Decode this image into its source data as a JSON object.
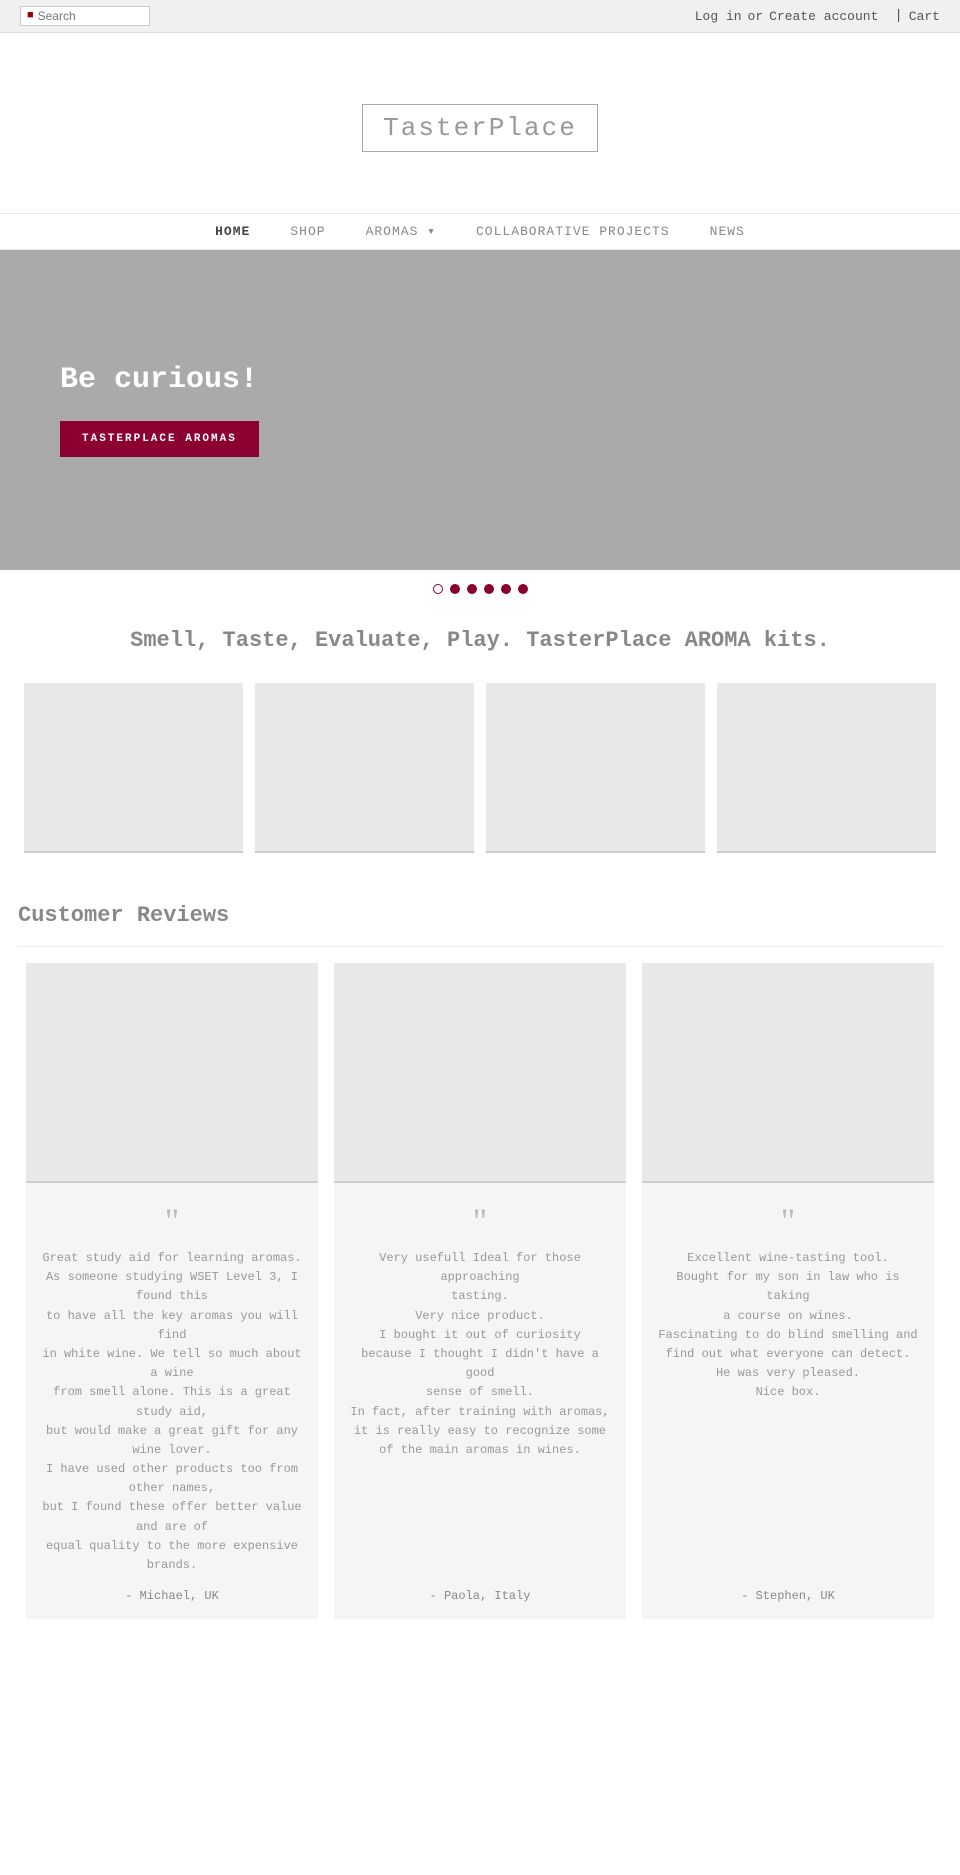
{
  "topbar": {
    "search_placeholder": "Search",
    "login_label": "Log in",
    "or_label": "or",
    "create_account_label": "Create account",
    "cart_divider": "|",
    "cart_label": "Cart"
  },
  "logo": {
    "text": "TasterPlace"
  },
  "nav": {
    "items": [
      {
        "label": "HOME",
        "active": true,
        "href": "#"
      },
      {
        "label": "SHOP",
        "active": false,
        "href": "#"
      },
      {
        "label": "AROMAS ▾",
        "active": false,
        "href": "#"
      },
      {
        "label": "COLLABORATIVE PROJECTS",
        "active": false,
        "href": "#"
      },
      {
        "label": "NEWS",
        "active": false,
        "href": "#"
      }
    ]
  },
  "hero": {
    "title": "Be curious!",
    "button_label": "TASTERPLACE AROMAS"
  },
  "carousel": {
    "dots": [
      {
        "type": "outline"
      },
      {
        "type": "filled"
      },
      {
        "type": "filled"
      },
      {
        "type": "filled"
      },
      {
        "type": "filled"
      },
      {
        "type": "filled"
      }
    ]
  },
  "tagline": {
    "text": "Smell, Taste, Evaluate, Play. TasterPlace AROMA kits."
  },
  "products": [
    {
      "name": ""
    },
    {
      "name": ""
    },
    {
      "name": ""
    },
    {
      "name": ""
    }
  ],
  "reviews_section": {
    "title": "Customer Reviews",
    "reviews": [
      {
        "quote_mark": "““",
        "text": "Great study aid for learning aromas.\nAs someone studying WSET Level 3, I found this\nto have all the key aromas you will find\nin white wine. We tell so much about a wine\nfrom smell alone. This is a great study aid,\nbut would make a great gift for any wine lover.\nI have used other products too from other names,\nbut I found these offer better value and are of\nequal quality to the more expensive brands.",
        "reviewer": "- Michael, UK"
      },
      {
        "quote_mark": "““",
        "text": "Very usefull Ideal for those approaching\ntasting.\nVery nice product.\nI bought it out of curiosity\nbecause I thought I didn't have a good\nsense of smell.\nIn fact, after training with aromas,\nit is really easy to recognize some\nof the main aromas in wines.",
        "reviewer": "- Paola, Italy"
      },
      {
        "quote_mark": "““",
        "text": "Excellent wine-tasting tool.\nBought for my son in law who is taking\na course on wines.\nFascinating to do blind smelling and\nfind out what everyone can detect.\nHe was very pleased.\nNice box.",
        "reviewer": "- Stephen, UK"
      }
    ]
  }
}
